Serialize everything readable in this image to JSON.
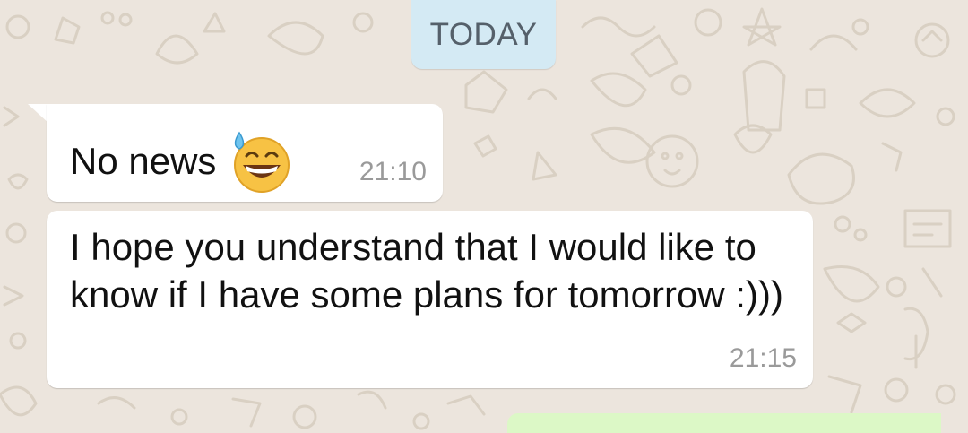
{
  "date_chip": {
    "label": "TODAY"
  },
  "messages": [
    {
      "text": "No news",
      "emoji": "grinning-face-with-sweat",
      "time": "21:10",
      "direction": "incoming"
    },
    {
      "text": "I hope you understand that I would like to know if I have some plans for tomorrow :)))",
      "time": "21:15",
      "direction": "incoming"
    }
  ],
  "colors": {
    "wallpaper": "#ece5dd",
    "incoming_bubble": "#ffffff",
    "outgoing_bubble": "#dcf8c6",
    "date_chip": "#d4eaf4",
    "timestamp": "#9a9a9a"
  }
}
